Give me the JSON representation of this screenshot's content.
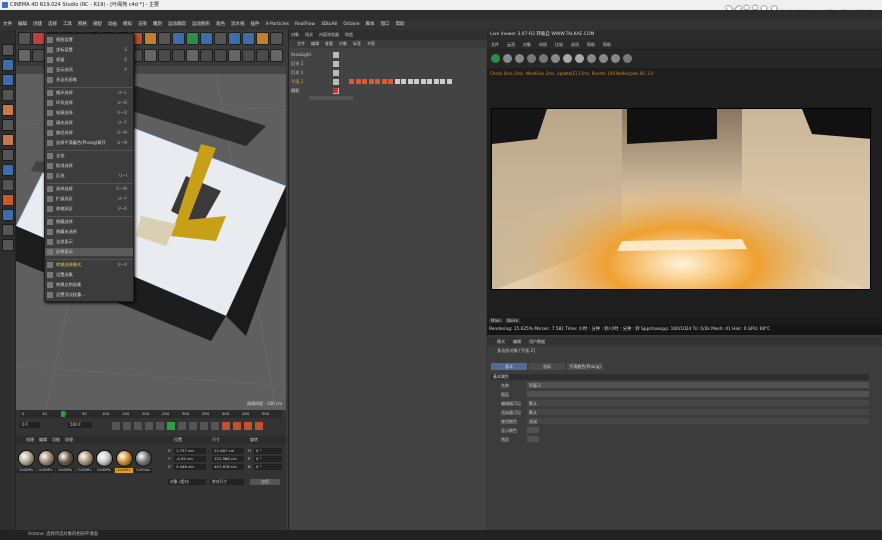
{
  "titlebar": {
    "title": "CINEMA 4D R19.024 Studio (RC - R19) - [叶阁苑 c4d *] - 主要"
  },
  "watermark": "YiiHuu.com",
  "menubar": [
    "文件",
    "编辑",
    "创建",
    "选择",
    "工具",
    "网格",
    "捕捉",
    "动画",
    "模拟",
    "渲染",
    "雕刻",
    "运动跟踪",
    "运动图形",
    "角色",
    "流水线",
    "插件",
    "X-Particles",
    "RealFlow",
    "3DtoAll",
    "Octane",
    "脚本",
    "窗口",
    "帮助"
  ],
  "context_menu": {
    "items": [
      {
        "label": "视图设置",
        "shortcut": ""
      },
      {
        "label": "坐标设置",
        "shortcut": "S"
      },
      {
        "label": "视窗",
        "shortcut": "E"
      },
      {
        "label": "显示选项",
        "shortcut": "X"
      },
      {
        "label": "多边形画笔",
        "shortcut": ""
      },
      {
        "label": "循环选择",
        "shortcut": "U~L"
      },
      {
        "label": "环状选择",
        "shortcut": "U~B"
      },
      {
        "label": "轮廓选择",
        "shortcut": "U~Q"
      },
      {
        "label": "填充选择",
        "shortcut": "U~F"
      },
      {
        "label": "路径选择",
        "shortcut": "U~M"
      },
      {
        "label": "选择平滑着色(Phong)断开",
        "shortcut": "U~N"
      },
      {
        "label": "全选",
        "shortcut": ""
      },
      {
        "label": "取消选择",
        "shortcut": ""
      },
      {
        "label": "反选",
        "shortcut": "U~I"
      },
      {
        "label": "选择连接",
        "shortcut": "U~W"
      },
      {
        "label": "扩展选区",
        "shortcut": "U~Y"
      },
      {
        "label": "收缩选区",
        "shortcut": "U~K"
      },
      {
        "label": "隐藏选择",
        "shortcut": ""
      },
      {
        "label": "隐藏未选择",
        "shortcut": ""
      },
      {
        "label": "全部显示",
        "shortcut": ""
      },
      {
        "label": "反转显示",
        "shortcut": ""
      },
      {
        "label": "转换选择模式",
        "shortcut": "U~X"
      },
      {
        "label": "设置选集",
        "shortcut": ""
      },
      {
        "label": "转换点到选集",
        "shortcut": ""
      },
      {
        "label": "设置顶点权重...",
        "shortcut": ""
      }
    ]
  },
  "object_manager": {
    "tabs": [
      "对象",
      "场次",
      "内容浏览器",
      "构造"
    ],
    "menu": [
      "文件",
      "编辑",
      "查看",
      "对象",
      "标签",
      "书签"
    ],
    "rows": [
      "AreaLight",
      "灯光 1",
      "灯光 1",
      "平面.2",
      "摄影"
    ]
  },
  "viewport": {
    "label": "网格间距 : 100 cm",
    "menu": [
      "查看",
      "摄像机",
      "显示",
      "选项",
      "过滤",
      "面板"
    ]
  },
  "live_viewer": {
    "title": "Live Viewer 3.07-R2 转载自 WWW.TALKAE.COM",
    "menu": [
      "文件",
      "云渲",
      "对象",
      "材质",
      "比较",
      "选项",
      "帮助",
      "帮助"
    ],
    "status": "Check 0ms./1ms. MeshGen 2ms. Update[E] 17ms. Render 100 Nodes/ples 80. 3.0",
    "tabs": [
      "Main",
      "Noise"
    ],
    "footer": "Rendering: 15.625%   Ms/sec: 7.581   Time: 小时 : 分钟 : 秒/小时 : 分钟 : 秒   Spp/maxspp: 160/1024   Tri: 0/2k   Mesh: 41   Hair: 0   GPU: 68°C"
  },
  "attributes": {
    "menu": [
      "模式",
      "编辑",
      "用户数据"
    ],
    "object": "多边形对象 [平面.2]",
    "tabs": [
      "基本",
      "坐标",
      "平滑着色(Phong)"
    ],
    "section": "基本属性",
    "fields": [
      {
        "label": "名称",
        "value": "平面.2"
      },
      {
        "label": "图层",
        "value": ""
      },
      {
        "label": "编辑器可见",
        "value": "默认"
      },
      {
        "label": "渲染器可见",
        "value": "默认"
      },
      {
        "label": "使用颜色",
        "value": "关闭"
      },
      {
        "label": "显示颜色",
        "value": ""
      },
      {
        "label": "透显",
        "value": ""
      }
    ]
  },
  "timeline": {
    "ticks": [
      "0",
      "10",
      "20",
      "50",
      "100",
      "150",
      "200",
      "250",
      "300",
      "350",
      "400",
      "450",
      "500"
    ],
    "current": "0 F",
    "start": "0 F",
    "end": "500 F"
  },
  "materials": {
    "menu": [
      "创建",
      "编辑",
      "功能",
      "纹理"
    ],
    "items": [
      "OctDiffu",
      "OctDiffu",
      "OctDiffu",
      "OctDiffu",
      "OctDiffu",
      "OctDiffu",
      "OctGlos"
    ]
  },
  "coordinates": {
    "headers": [
      "位置",
      "尺寸",
      "旋转"
    ],
    "rows": [
      {
        "axis": "X",
        "pos": "1.757 cm",
        "size": "22.487 cm",
        "rot_label": "H",
        "rot": "0 °"
      },
      {
        "axis": "Y",
        "pos": "-4.05 cm",
        "size": "122.988 cm",
        "rot_label": "P",
        "rot": "0 °"
      },
      {
        "axis": "Z",
        "pos": "3.448 cm",
        "size": "447.878 cm",
        "rot_label": "B",
        "rot": "0 °"
      }
    ],
    "mode": "对象 (相对)",
    "scale_mode": "绝对尺寸",
    "apply": "应用"
  },
  "statusbar": {
    "text": "Octane:   选择所选对象的相同平滑面"
  },
  "colors": {
    "accent": "#e8d24a",
    "selected_material": "#e0a020",
    "render_progress": "#2ea043"
  }
}
